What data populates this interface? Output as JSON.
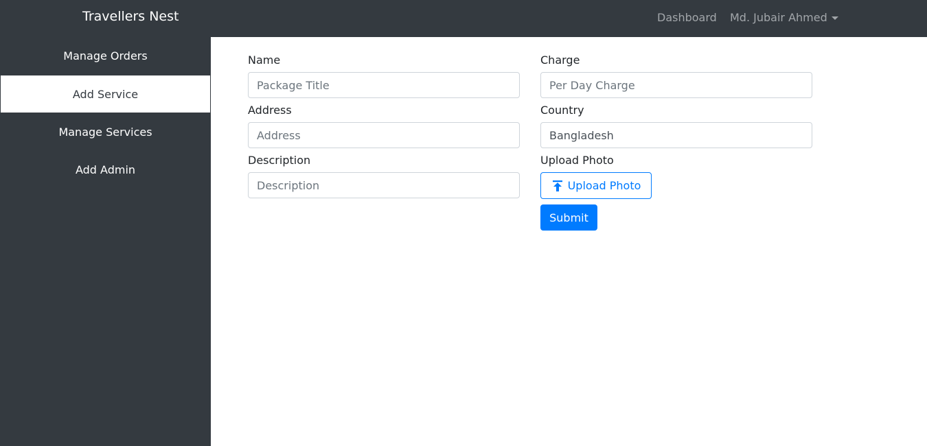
{
  "navbar": {
    "brand": "Travellers Nest",
    "links": {
      "dashboard": "Dashboard",
      "user": "Md. Jubair Ahmed"
    }
  },
  "sidebar": {
    "items": [
      {
        "label": "Manage Orders"
      },
      {
        "label": "Add Service"
      },
      {
        "label": "Manage Services"
      },
      {
        "label": "Add Admin"
      }
    ],
    "active_item": "Add Service"
  },
  "form": {
    "name": {
      "label": "Name",
      "placeholder": "Package Title",
      "value": ""
    },
    "charge": {
      "label": "Charge",
      "placeholder": "Per Day Charge",
      "value": ""
    },
    "address": {
      "label": "Address",
      "placeholder": "Address",
      "value": ""
    },
    "country": {
      "label": "Country",
      "placeholder": "",
      "value": "Bangladesh"
    },
    "description": {
      "label": "Description",
      "placeholder": "Description",
      "value": ""
    },
    "upload": {
      "label": "Upload Photo",
      "button_label": "Upload Photo",
      "icon": "upload-icon"
    },
    "submit_label": "Submit"
  },
  "colors": {
    "dark_bg": "#343a40",
    "primary": "#007bff",
    "muted_link": "#a2a6aa",
    "placeholder": "#6c757d"
  }
}
